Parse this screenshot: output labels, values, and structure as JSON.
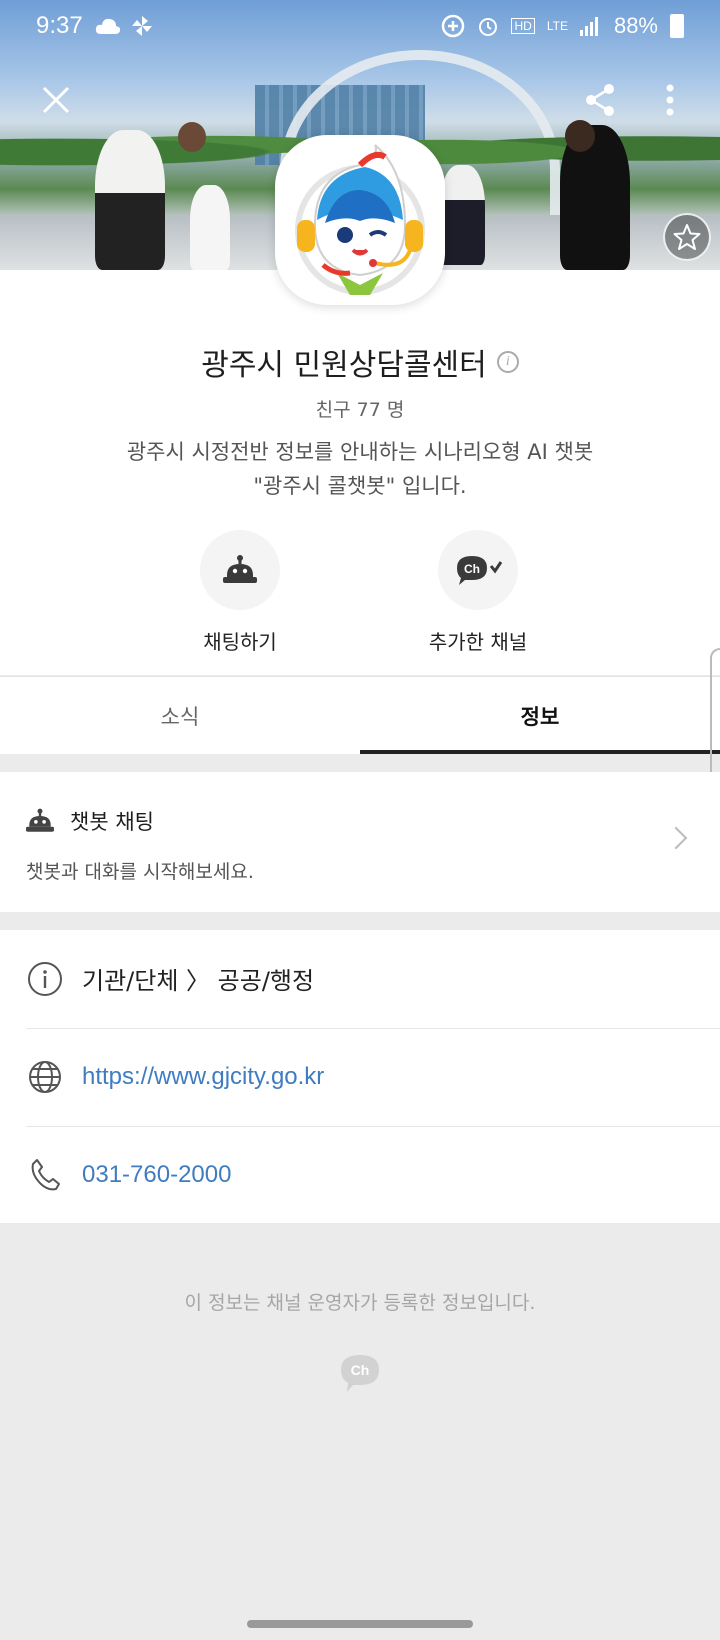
{
  "status_bar": {
    "time": "9:37",
    "battery": "88%",
    "network": "LTE",
    "hd_voice": "HD"
  },
  "profile": {
    "name": "광주시 민원상담콜센터",
    "friends": "친구 77 명",
    "description_line1": "광주시 시정전반 정보를 안내하는 시나리오형 AI 챗봇",
    "description_line2": "\"광주시 콜챗봇\" 입니다.",
    "actions": {
      "chat_label": "채팅하기",
      "channel_label": "추가한 채널",
      "channel_icon_text": "Ch"
    }
  },
  "tabs": {
    "news": "소식",
    "info": "정보",
    "active": "정보"
  },
  "chatbot_card": {
    "title": "챗봇 채팅",
    "subtitle": "챗봇과 대화를 시작해보세요."
  },
  "info": {
    "category": "기관/단체 〉 공공/행정",
    "website": "https://www.gjcity.go.kr",
    "phone": "031-760-2000"
  },
  "footer": {
    "note": "이 정보는 채널 운영자가 등록한 정보입니다.",
    "logo_text": "Ch"
  },
  "colors": {
    "link": "#3f7cc0",
    "tab_indicator": "#222222",
    "background": "#ebebeb"
  }
}
